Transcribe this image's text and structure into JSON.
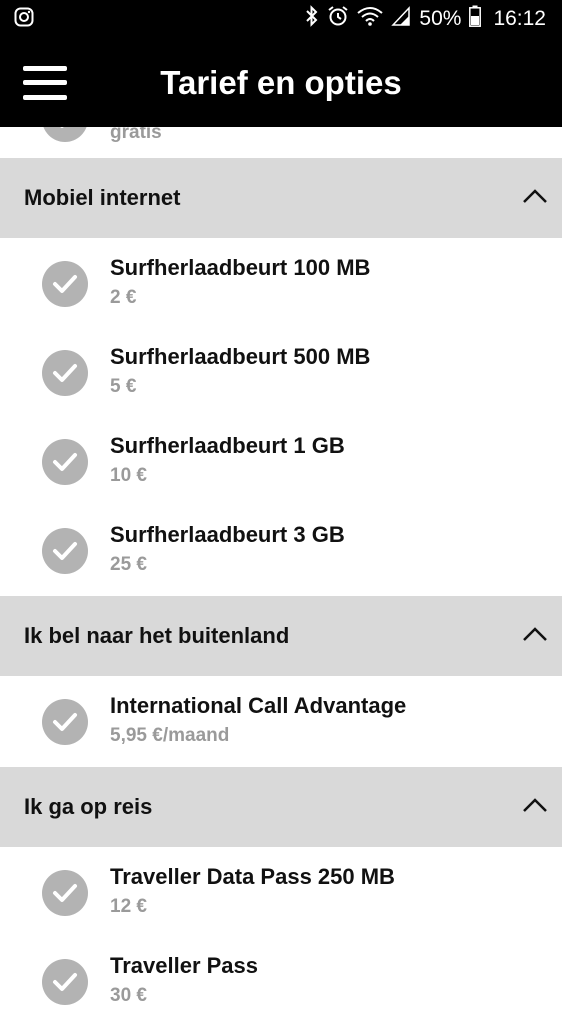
{
  "status_bar": {
    "battery_percent": "50%",
    "time": "16:12"
  },
  "app_bar": {
    "title": "Tarief en opties"
  },
  "partial_item": {
    "price": "gratis"
  },
  "sections": [
    {
      "title": "Mobiel internet",
      "items": [
        {
          "name": "Surfherlaadbeurt 100 MB",
          "price": "2 €"
        },
        {
          "name": "Surfherlaadbeurt 500 MB",
          "price": "5 €"
        },
        {
          "name": "Surfherlaadbeurt 1 GB",
          "price": "10 €"
        },
        {
          "name": "Surfherlaadbeurt 3 GB",
          "price": "25 €"
        }
      ]
    },
    {
      "title": "Ik bel naar het buitenland",
      "items": [
        {
          "name": "International Call Advantage",
          "price": "5,95 €/maand"
        }
      ]
    },
    {
      "title": "Ik ga op reis",
      "items": [
        {
          "name": "Traveller Data Pass 250 MB",
          "price": "12 €"
        },
        {
          "name": "Traveller Pass",
          "price": "30 €"
        }
      ]
    }
  ],
  "colors": {
    "header_bg": "#000000",
    "section_bg": "#d9d9d9",
    "check_bg": "#b3b3b3",
    "price_text": "#9a9a9a"
  }
}
